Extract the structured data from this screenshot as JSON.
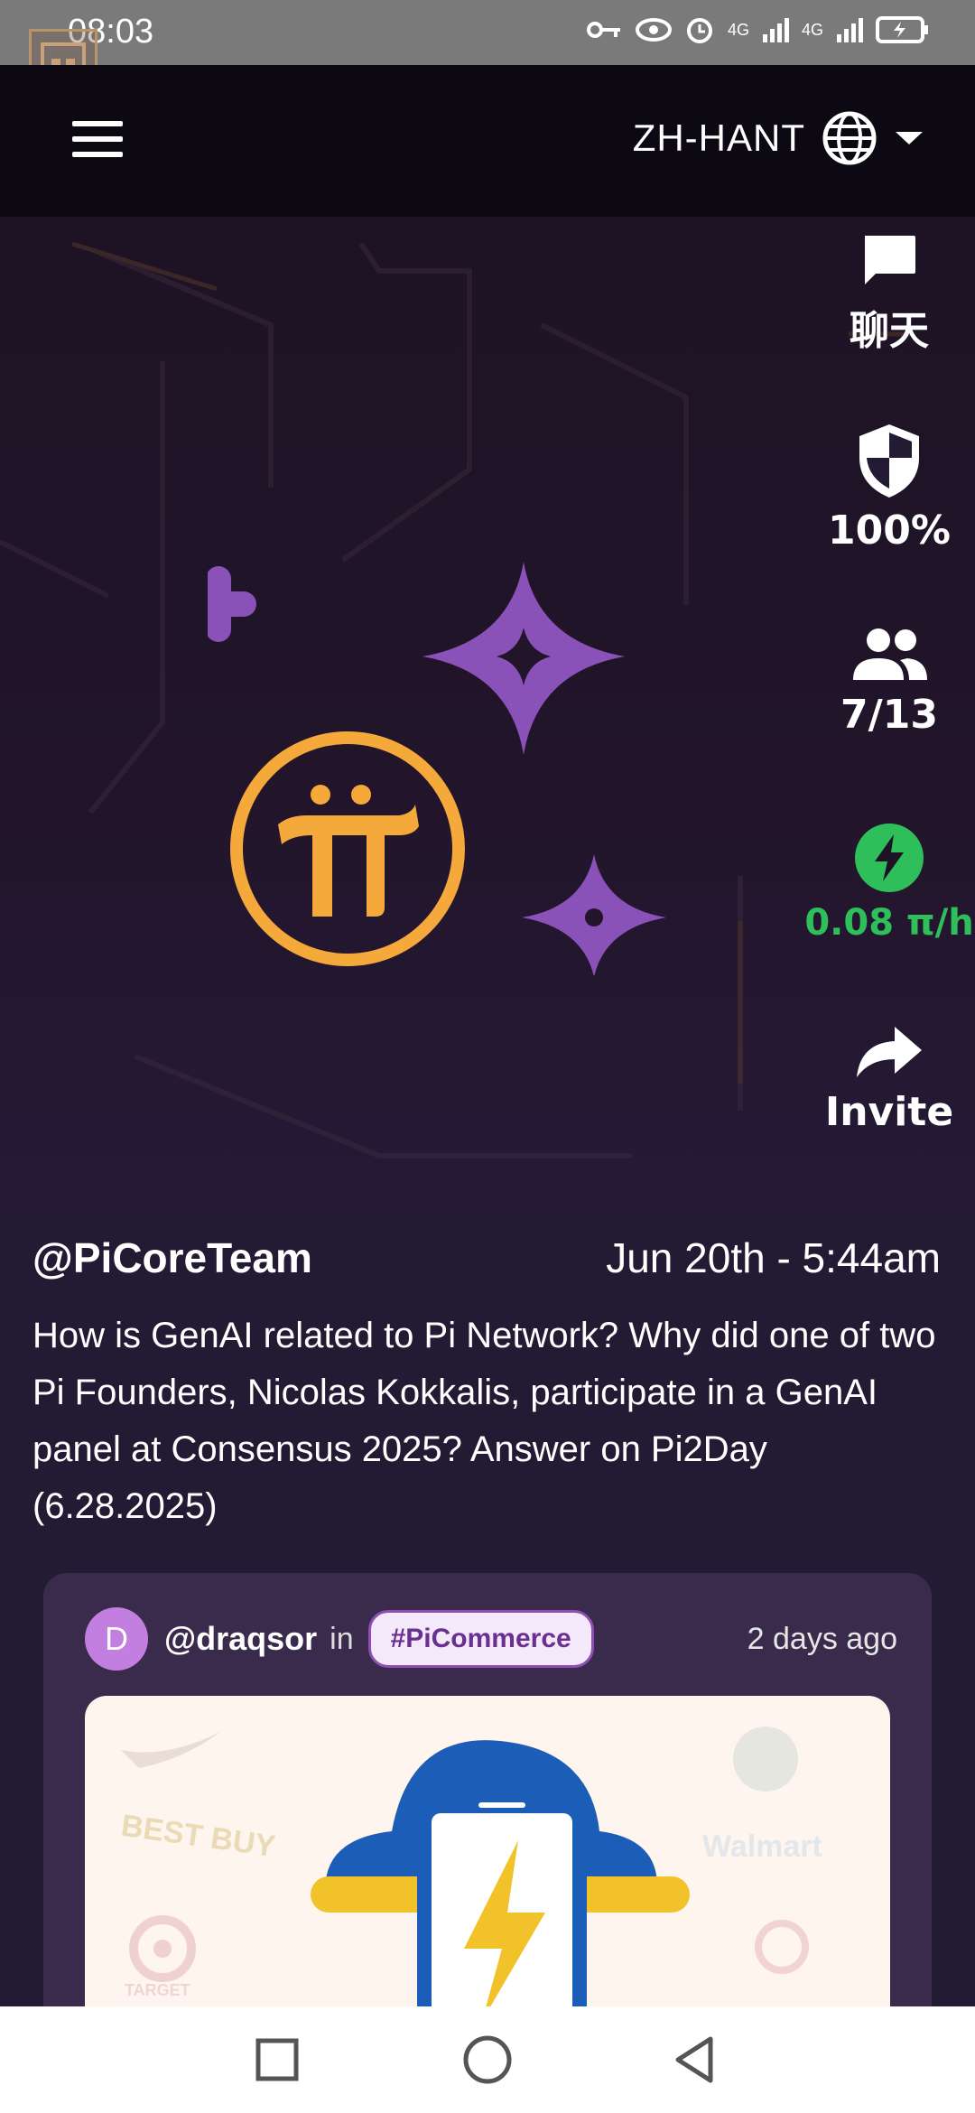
{
  "status_bar": {
    "time": "08:03",
    "network_1": "4G",
    "network_2": "4G"
  },
  "header": {
    "language": "ZH-HANT",
    "menu_icon": "hamburger-icon",
    "globe_icon": "globe-icon"
  },
  "side_actions": {
    "chat": {
      "label": "聊天",
      "icon": "chat-icon"
    },
    "security": {
      "label": "100%",
      "icon": "shield-icon"
    },
    "team": {
      "label": "7/13",
      "icon": "people-icon"
    },
    "mining": {
      "label": "0.08 π/h",
      "icon": "lightning-icon",
      "color": "#2fbf5a"
    },
    "invite": {
      "label": "Invite",
      "icon": "share-arrow-icon"
    }
  },
  "post": {
    "author": "@PiCoreTeam",
    "date": "Jun 20th - 5:44am",
    "body": "How is GenAI related to Pi Network? Why did one of two Pi Founders, Nicolas Kokkalis, participate in a GenAI panel at Consensus 2025? Answer on Pi2Day (6.28.2025)"
  },
  "card": {
    "avatar_letter": "D",
    "user": "@draqsor",
    "in_text": "in",
    "tag": "#PiCommerce",
    "time": "2 days ago",
    "image_brands": [
      "BEST BUY",
      "Walmart",
      "TARGET"
    ]
  },
  "colors": {
    "accent_purple": "#8a52b8",
    "pi_gold": "#f5a93a",
    "mining_green": "#2fbf5a"
  }
}
